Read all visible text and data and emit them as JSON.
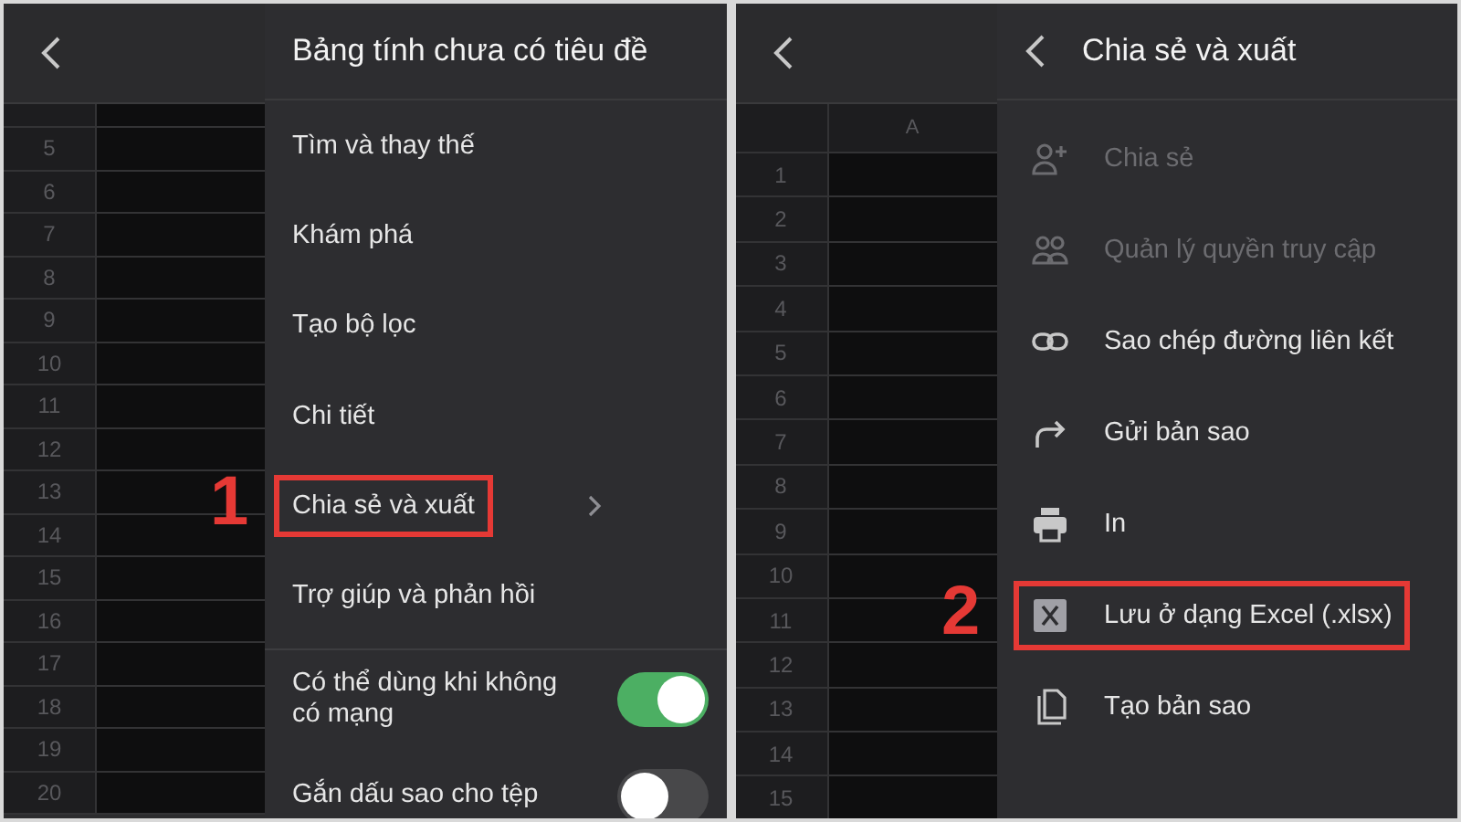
{
  "screens": [
    {
      "sheet": {
        "rows": [
          "5",
          "6",
          "7",
          "8",
          "9",
          "10",
          "11",
          "12",
          "13",
          "14",
          "15",
          "16",
          "17",
          "18",
          "19",
          "20"
        ]
      },
      "menu": {
        "title": "Bảng tính chưa có tiêu đề",
        "items": [
          {
            "label": "Tìm và thay thế",
            "kind": "text",
            "disabled": false
          },
          {
            "label": "Khám phá",
            "kind": "text",
            "disabled": false
          },
          {
            "label": "Tạo bộ lọc",
            "kind": "text",
            "disabled": false
          },
          {
            "label": "Chi tiết",
            "kind": "text",
            "disabled": false
          },
          {
            "label": "Chia sẻ và xuất",
            "kind": "text",
            "disabled": false,
            "submenu": true,
            "callout": "1"
          },
          {
            "label": "Trợ giúp và phản hồi",
            "kind": "text",
            "disabled": false
          }
        ],
        "toggles": [
          {
            "label": "Có thể dùng khi không có mạng",
            "on": true
          },
          {
            "label": "Gắn dấu sao cho tệp",
            "on": false
          }
        ]
      }
    },
    {
      "sheet": {
        "column_header": "A",
        "rows": [
          "1",
          "2",
          "3",
          "4",
          "5",
          "6",
          "7",
          "8",
          "9",
          "10",
          "11",
          "12",
          "13",
          "14",
          "15"
        ]
      },
      "menu": {
        "title": "Chia sẻ và xuất",
        "back": true,
        "items": [
          {
            "label": "Chia sẻ",
            "kind": "share",
            "disabled": true
          },
          {
            "label": "Quản lý quyền truy cập",
            "kind": "people",
            "disabled": true
          },
          {
            "label": "Sao chép đường liên kết",
            "kind": "link",
            "disabled": false
          },
          {
            "label": "Gửi bản sao",
            "kind": "forward",
            "disabled": false
          },
          {
            "label": "In",
            "kind": "print",
            "disabled": false
          },
          {
            "label": "Lưu ở dạng Excel (.xlsx)",
            "kind": "excel",
            "disabled": false,
            "callout": "2"
          },
          {
            "label": "Tạo bản sao",
            "kind": "copy",
            "disabled": false
          }
        ]
      }
    }
  ]
}
